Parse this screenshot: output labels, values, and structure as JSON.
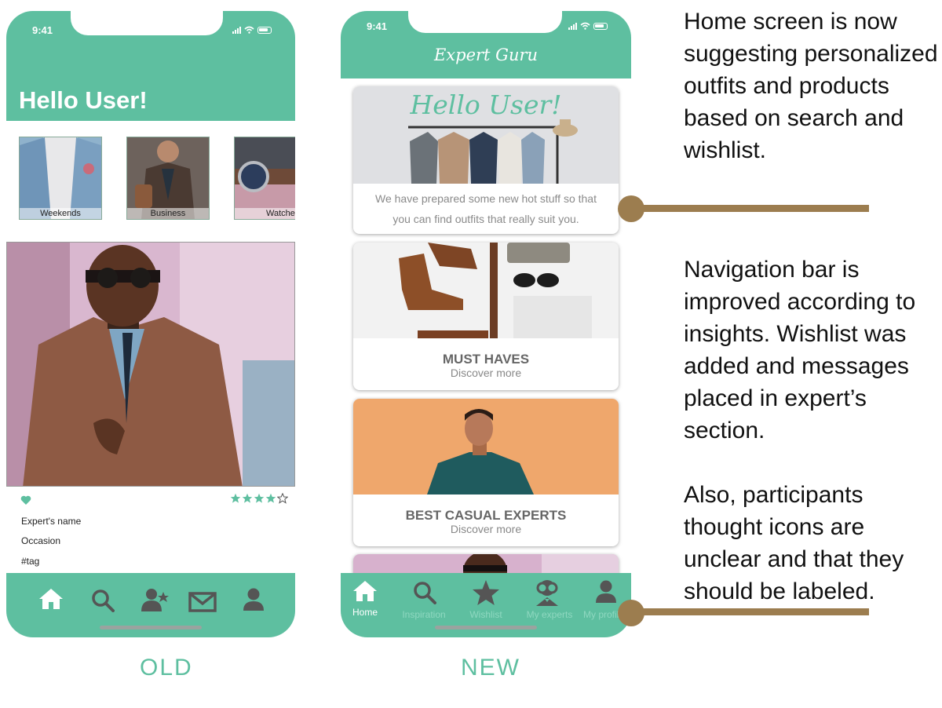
{
  "colors": {
    "accent": "#5ebfa0",
    "connector": "#9c7d4f"
  },
  "old_screen": {
    "status_time": "9:41",
    "greeting": "Hello User!",
    "categories": [
      {
        "label": "Weekends"
      },
      {
        "label": "Business"
      },
      {
        "label": "Watches"
      }
    ],
    "post": {
      "expert_name": "Expert's name",
      "occasion": "Occasion",
      "tag": "#tag",
      "rating": 4,
      "rating_max": 5
    },
    "nav_icons": [
      "home-icon",
      "search-icon",
      "experts-icon",
      "messages-icon",
      "profile-icon"
    ],
    "caption": "OLD"
  },
  "new_screen": {
    "status_time": "9:41",
    "app_title": "Expert Guru",
    "hello_card": {
      "greeting": "Hello User!",
      "text": "We have prepared some new  hot stuff so that you can find  outfits that really suit you."
    },
    "cards": [
      {
        "title": "MUST HAVES",
        "subtitle": "Discover more"
      },
      {
        "title": "BEST CASUAL EXPERTS",
        "subtitle": "Discover more"
      }
    ],
    "nav": [
      {
        "label": "Home",
        "icon": "home-icon"
      },
      {
        "label": "Inspiration",
        "icon": "search-icon"
      },
      {
        "label": "Wishlist",
        "icon": "star-icon"
      },
      {
        "label": "My experts",
        "icon": "experts-icon"
      },
      {
        "label": "My profile",
        "icon": "profile-icon"
      }
    ],
    "caption": "NEW"
  },
  "annotations": {
    "home": "Home screen is now suggesting personalized outfits and products based on search and wishlist.",
    "nav": "Navigation bar  is improved according to insights. Wishlist was added and messages placed in expert’s section.",
    "icons": "Also, participants thought icons are unclear and that they should be labeled."
  }
}
